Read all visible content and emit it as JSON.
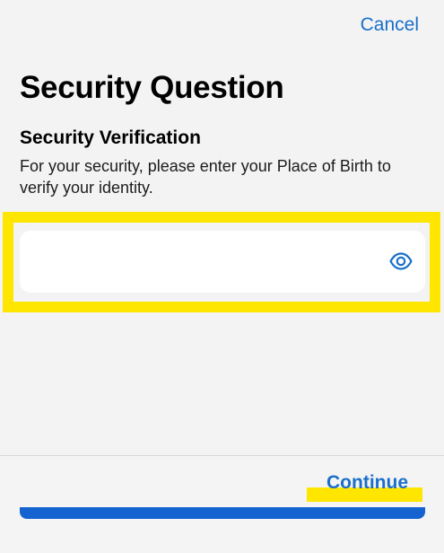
{
  "header": {
    "cancel_label": "Cancel",
    "title": "Security Question"
  },
  "content": {
    "subtitle": "Security Verification",
    "description": "For your security, please enter your Place of Birth to verify your identity.",
    "input": {
      "value": "",
      "placeholder": ""
    },
    "icons": {
      "reveal": "eye-icon"
    }
  },
  "footer": {
    "continue_label": "Continue"
  },
  "colors": {
    "accent": "#1a6fc9",
    "highlight": "#ffe600",
    "bar": "#1563d0",
    "background": "#f3f3f4"
  }
}
